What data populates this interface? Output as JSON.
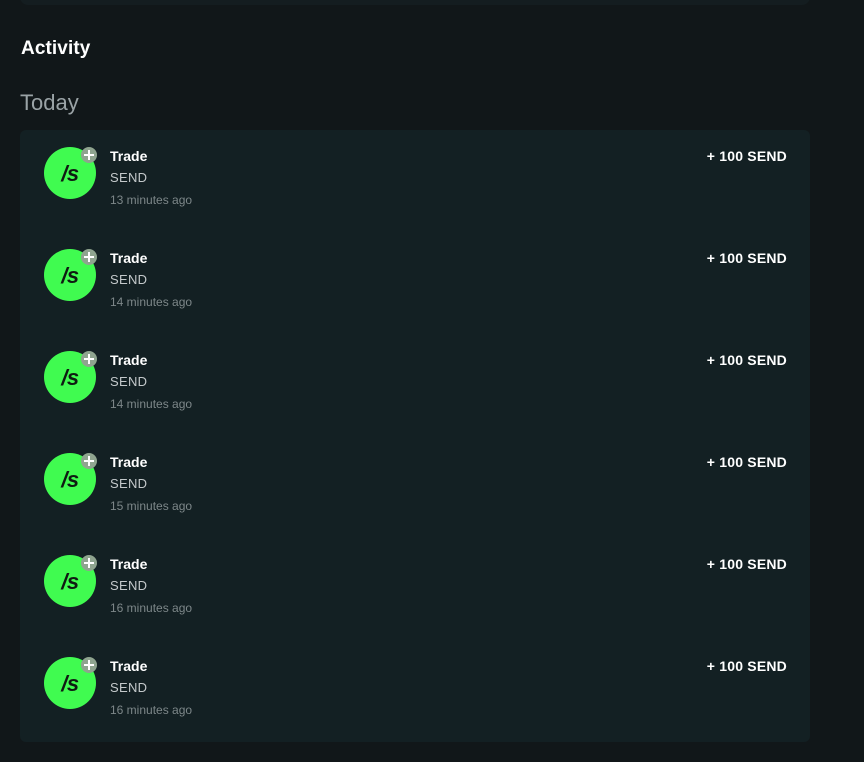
{
  "activity": {
    "title": "Activity",
    "day_label": "Today",
    "items": [
      {
        "avatar_text": "/s",
        "badge_icon": "plus-icon",
        "title": "Trade",
        "token": "SEND",
        "time": "13 minutes ago",
        "amount": "+ 100 SEND"
      },
      {
        "avatar_text": "/s",
        "badge_icon": "plus-icon",
        "title": "Trade",
        "token": "SEND",
        "time": "14 minutes ago",
        "amount": "+ 100 SEND"
      },
      {
        "avatar_text": "/s",
        "badge_icon": "plus-icon",
        "title": "Trade",
        "token": "SEND",
        "time": "14 minutes ago",
        "amount": "+ 100 SEND"
      },
      {
        "avatar_text": "/s",
        "badge_icon": "plus-icon",
        "title": "Trade",
        "token": "SEND",
        "time": "15 minutes ago",
        "amount": "+ 100 SEND"
      },
      {
        "avatar_text": "/s",
        "badge_icon": "plus-icon",
        "title": "Trade",
        "token": "SEND",
        "time": "16 minutes ago",
        "amount": "+ 100 SEND"
      },
      {
        "avatar_text": "/s",
        "badge_icon": "plus-icon",
        "title": "Trade",
        "token": "SEND",
        "time": "16 minutes ago",
        "amount": "+ 100 SEND"
      }
    ]
  },
  "colors": {
    "background": "#111719",
    "card": "#132023",
    "avatar": "#40fb50",
    "badge": "#8fa48f"
  }
}
